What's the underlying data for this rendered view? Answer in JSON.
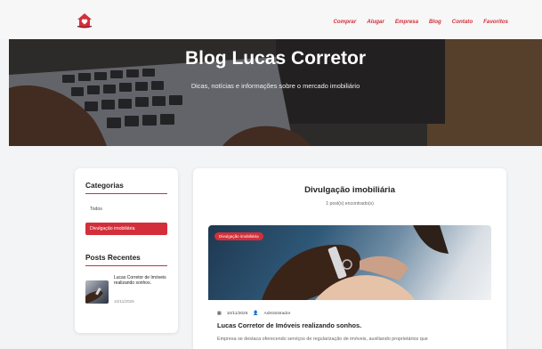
{
  "nav": {
    "logo_icon": "house-heart-logo-icon",
    "brand_color": "#d32f3a",
    "items": [
      {
        "label": "Comprar"
      },
      {
        "label": "Alugar"
      },
      {
        "label": "Empresa"
      },
      {
        "label": "Blog"
      },
      {
        "label": "Contato"
      },
      {
        "label": "Favoritos"
      }
    ]
  },
  "hero": {
    "title": "Blog Lucas Corretor",
    "subtitle": "Dicas, notícias e informações sobre o mercado imobiliário"
  },
  "sidebar": {
    "categories_heading": "Categorias",
    "categories": [
      {
        "label": "Todos",
        "active": false
      },
      {
        "label": "Divulgação imobiliária",
        "active": true
      }
    ],
    "recent_heading": "Posts Recentes",
    "recent_posts": [
      {
        "title": "Lucas Corretor de Imóveis realizando sonhos.",
        "date": "10/11/2025"
      }
    ]
  },
  "main": {
    "title": "Divulgação imobiliária",
    "count_text": "1 post(s) encontrado(s)",
    "post": {
      "badge": "Divulgação imobiliária",
      "date_icon": "calendar-icon",
      "date": "10/11/2025",
      "author_icon": "user-icon",
      "author": "Administrador",
      "title": "Lucas Corretor de Imóveis realizando sonhos.",
      "excerpt": "Empresa se destaca oferecendo serviços de regularização de imóveis, auxiliando proprietários que"
    }
  }
}
